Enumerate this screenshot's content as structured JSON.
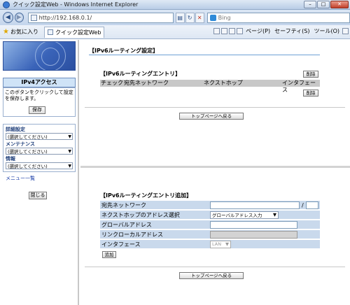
{
  "window": {
    "title": "クイック設定Web - Windows Internet Explorer"
  },
  "address_bar": {
    "url": "http://192.168.0.1/",
    "search_placeholder": "Bing"
  },
  "favorites_bar": {
    "favorites_label": "お気に入り",
    "tab_title": "クイック設定Web"
  },
  "command_bar": {
    "page": "ページ(P)",
    "safety": "セーフティ(S)",
    "tools": "ツール(O)"
  },
  "sidebar": {
    "ipv4_button": "IPv4アクセス",
    "note": "このボタンをクリックして設定を保存します。",
    "save_button": "保存",
    "sections": [
      {
        "heading": "詳細設定",
        "select": "(選択してください)"
      },
      {
        "heading": "メンテナンス",
        "select": "(選択してください)"
      },
      {
        "heading": "情報",
        "select": "(選択してください)"
      }
    ],
    "menu_list": "メニュー一覧",
    "close_button": "閉じる"
  },
  "top_frame": {
    "page_title": "【IPv6ルーティング設定】",
    "entry_title": "【IPv6ルーティングエントリ】",
    "delete_button": "削除",
    "columns": [
      "チェック",
      "宛先ネットワーク",
      "ネクストホップ",
      "インタフェース"
    ],
    "top_page_button": "トップページへ戻る"
  },
  "bottom_frame": {
    "add_title": "【IPv6ルーティングエントリ追加】",
    "rows": [
      {
        "label": "宛先ネットワーク",
        "value": ""
      },
      {
        "label": "ネクストホップのアドレス選択",
        "value": "グローバルアドレス入力"
      },
      {
        "label": "グローバルアドレス",
        "value": ""
      },
      {
        "label": "リンクローカルアドレス",
        "value": ""
      },
      {
        "label": "インタフェース",
        "value": "LAN"
      }
    ],
    "prefix_separator": "/",
    "add_button": "追加",
    "top_page_button": "トップページへ戻る"
  }
}
